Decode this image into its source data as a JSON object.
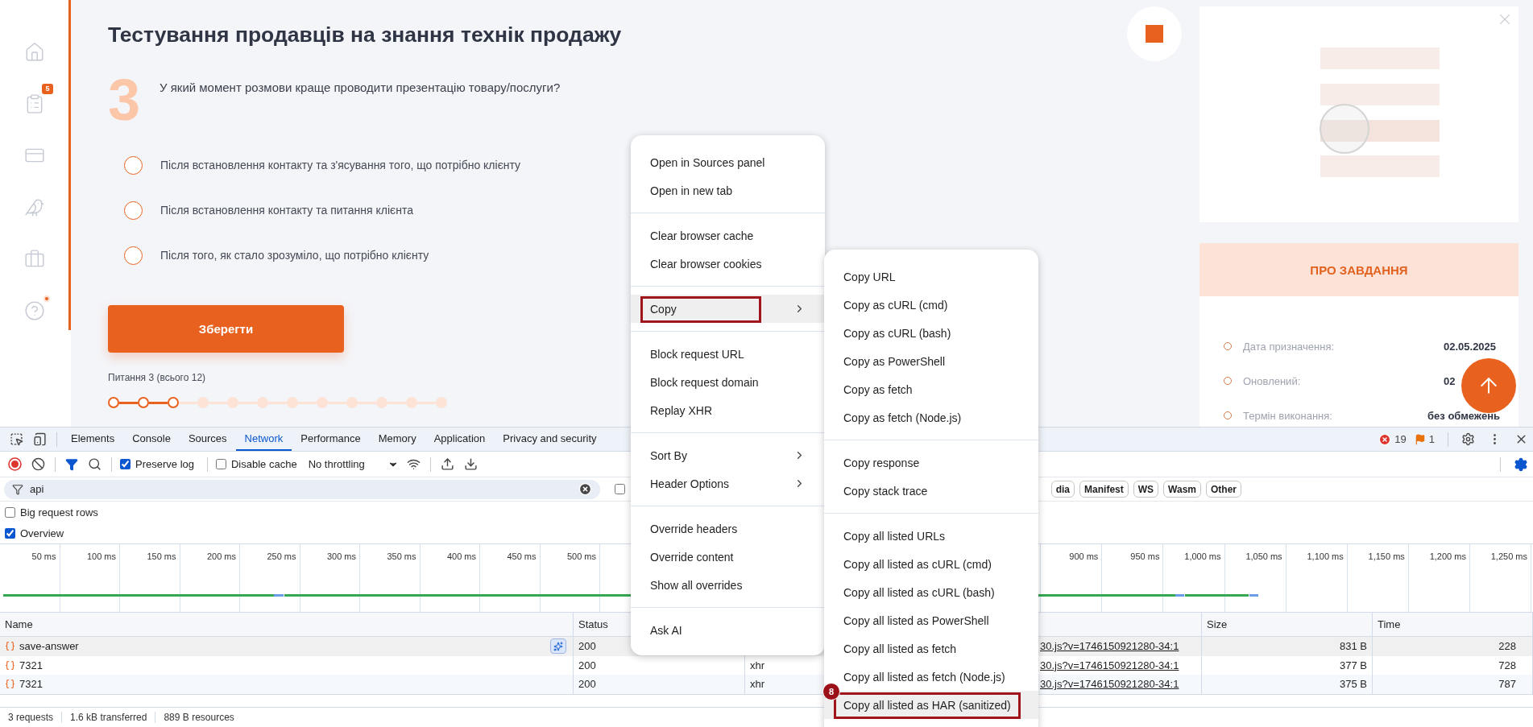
{
  "sidebar": {
    "items": [
      {
        "kind": "home"
      },
      {
        "kind": "tasks",
        "badge": "5"
      },
      {
        "kind": "certificate"
      },
      {
        "kind": "owl"
      },
      {
        "kind": "briefcase"
      },
      {
        "kind": "help",
        "notification": true
      }
    ]
  },
  "test": {
    "title": "Тестування продавців на знання технік продажу",
    "question_number": "3",
    "question": "У який момент розмови краще проводити презентацію товару/послуги?",
    "options": [
      {
        "label": "Після встановлення контакту та з'ясування того, що потрібно клієнту",
        "selected": false
      },
      {
        "label": "Після встановлення контакту та питання клієнта",
        "selected": false
      },
      {
        "label": "Після того, як стало зрозуміло, що потрібно клієнту",
        "selected": false
      }
    ],
    "save_button": "Зберегти",
    "progress_label": "Питання 3 (всього 12)",
    "steps": [
      {
        "reached": true
      },
      {
        "reached": true
      },
      {
        "reached": true
      },
      {
        "reached": false
      },
      {
        "reached": false
      },
      {
        "reached": false
      },
      {
        "reached": false
      },
      {
        "reached": false
      },
      {
        "reached": false
      },
      {
        "reached": false
      },
      {
        "reached": false
      },
      {
        "reached": false
      }
    ]
  },
  "task_panel": {
    "header": "ПРО ЗАВДАННЯ",
    "details": [
      {
        "label": "Дата призначення:",
        "value": "02.05.2025"
      },
      {
        "label": "Оновлений:",
        "value": "02"
      },
      {
        "label": "Термін виконання:",
        "value": "без обмежень"
      }
    ]
  },
  "devtools": {
    "tabs": [
      {
        "label": "Elements",
        "selected": false
      },
      {
        "label": "Console",
        "selected": false
      },
      {
        "label": "Sources",
        "selected": false
      },
      {
        "label": "Network",
        "selected": true
      },
      {
        "label": "Performance",
        "selected": false
      },
      {
        "label": "Memory",
        "selected": false
      },
      {
        "label": "Application",
        "selected": false
      },
      {
        "label": "Privacy and security",
        "selected": false
      }
    ],
    "issues": {
      "errors": "19",
      "warnings": "1"
    },
    "toolbar": {
      "preserve_log": {
        "label": "Preserve log",
        "checked": true
      },
      "disable_cache": {
        "label": "Disable cache",
        "checked": false
      },
      "throttling": "No throttling"
    },
    "filter": {
      "value": "api",
      "checkbox_checked": false
    },
    "type_chips": [
      "dia",
      "Manifest",
      "WS",
      "Wasm",
      "Other"
    ],
    "options": [
      {
        "label": "Big request rows",
        "checked": false
      },
      {
        "label": "Overview",
        "checked": true
      }
    ],
    "overview": {
      "ticks_left": [
        "50 ms",
        "100 ms",
        "150 ms",
        "200 ms",
        "250 ms",
        "300 ms",
        "350 ms",
        "400 ms",
        "450 ms",
        "500 ms"
      ],
      "ticks_right": [
        "900 ms",
        "950 ms",
        "1,000 ms",
        "1,050 ms",
        "1,100 ms",
        "1,150 ms",
        "1,200 ms",
        "1,250 ms"
      ]
    },
    "table": {
      "columns": {
        "name": "Name",
        "status": "Status",
        "size": "Size",
        "time": "Time"
      },
      "rows": [
        {
          "name": "save-answer",
          "status": "200",
          "initiator": "30.js?v=1746150921280-34:1",
          "size": "831 B",
          "time": "228",
          "selected": true
        },
        {
          "name": "7321",
          "status": "200",
          "type": "xhr",
          "initiator": "30.js?v=1746150921280-34:1",
          "size": "377 B",
          "time": "728",
          "selected": false
        },
        {
          "name": "7321",
          "status": "200",
          "type": "xhr",
          "initiator": "30.js?v=1746150921280-34:1",
          "size": "375 B",
          "time": "787",
          "selected": false
        }
      ]
    },
    "status_bar": [
      "3 requests",
      "1.6 kB transferred",
      "889 B resources"
    ]
  },
  "context_menu": {
    "groups": [
      [
        {
          "label": "Open in Sources panel",
          "submenu": false,
          "selected": false,
          "annotated": false
        },
        {
          "label": "Open in new tab",
          "submenu": false,
          "selected": false,
          "annotated": false
        }
      ],
      [
        {
          "label": "Clear browser cache",
          "submenu": false,
          "selected": false,
          "annotated": false
        },
        {
          "label": "Clear browser cookies",
          "submenu": false,
          "selected": false,
          "annotated": false
        }
      ],
      [
        {
          "label": "Copy",
          "submenu": true,
          "selected": true,
          "annotated": true
        }
      ],
      [
        {
          "label": "Block request URL",
          "submenu": false,
          "selected": false,
          "annotated": false
        },
        {
          "label": "Block request domain",
          "submenu": false,
          "selected": false,
          "annotated": false
        },
        {
          "label": "Replay XHR",
          "submenu": false,
          "selected": false,
          "annotated": false
        }
      ],
      [
        {
          "label": "Sort By",
          "submenu": true,
          "selected": false,
          "annotated": false
        },
        {
          "label": "Header Options",
          "submenu": true,
          "selected": false,
          "annotated": false
        }
      ],
      [
        {
          "label": "Override headers",
          "submenu": false,
          "selected": false,
          "annotated": false
        },
        {
          "label": "Override content",
          "submenu": false,
          "selected": false,
          "annotated": false
        },
        {
          "label": "Show all overrides",
          "submenu": false,
          "selected": false,
          "annotated": false
        }
      ],
      [
        {
          "label": "Ask AI",
          "submenu": false,
          "selected": false,
          "annotated": false
        }
      ]
    ]
  },
  "copy_submenu": {
    "groups": [
      [
        {
          "label": "Copy URL",
          "selected": false,
          "annotated": false
        },
        {
          "label": "Copy as cURL (cmd)",
          "selected": false,
          "annotated": false
        },
        {
          "label": "Copy as cURL (bash)",
          "selected": false,
          "annotated": false
        },
        {
          "label": "Copy as PowerShell",
          "selected": false,
          "annotated": false
        },
        {
          "label": "Copy as fetch",
          "selected": false,
          "annotated": false
        },
        {
          "label": "Copy as fetch (Node.js)",
          "selected": false,
          "annotated": false
        }
      ],
      [
        {
          "label": "Copy response",
          "selected": false,
          "annotated": false
        },
        {
          "label": "Copy stack trace",
          "selected": false,
          "annotated": false
        }
      ],
      [
        {
          "label": "Copy all listed URLs",
          "selected": false,
          "annotated": false
        },
        {
          "label": "Copy all listed as cURL (cmd)",
          "selected": false,
          "annotated": false
        },
        {
          "label": "Copy all listed as cURL (bash)",
          "selected": false,
          "annotated": false
        },
        {
          "label": "Copy all listed as PowerShell",
          "selected": false,
          "annotated": false
        },
        {
          "label": "Copy all listed as fetch",
          "selected": false,
          "annotated": false
        },
        {
          "label": "Copy all listed as fetch (Node.js)",
          "selected": false,
          "annotated": false
        },
        {
          "label": "Copy all listed as HAR (sanitized)",
          "selected": true,
          "annotated": true,
          "badge": "8"
        }
      ]
    ]
  }
}
